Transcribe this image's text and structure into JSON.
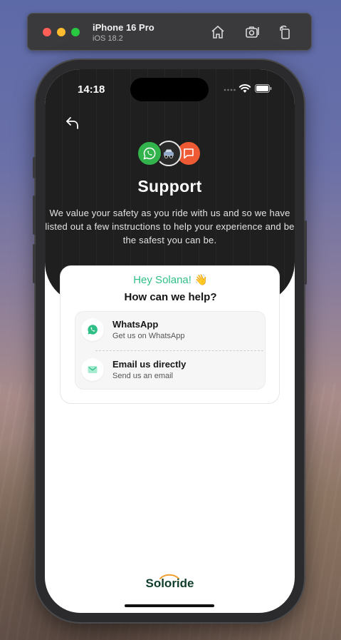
{
  "simulator": {
    "device_name": "iPhone 16 Pro",
    "os_version": "iOS 18.2",
    "icons": [
      "home-icon",
      "screenshot-icon",
      "rotate-icon"
    ]
  },
  "status_bar": {
    "time": "14:18",
    "icons": [
      "cellular-signal-icon",
      "wifi-icon",
      "battery-icon"
    ]
  },
  "header": {
    "back_icon": "back-arrow-icon",
    "cluster_icons": [
      "whatsapp-icon",
      "car-avatar-icon",
      "chat-bubble-icon"
    ],
    "title": "Support",
    "subtitle": "We value your safety as you ride with us and so we have listed out a few instructions to help your experience and be the safest you can be."
  },
  "card": {
    "greeting": "Hey Solana! 👋",
    "question": "How can we help?",
    "options": [
      {
        "icon": "whatsapp-icon",
        "title": "WhatsApp",
        "description": "Get  us on WhatsApp"
      },
      {
        "icon": "email-icon",
        "title": "Email us directly",
        "description": "Send us an email"
      }
    ]
  },
  "footer": {
    "brand": "Soloride"
  },
  "colors": {
    "accent_green": "#2fbf86",
    "header_dark": "#1f1f1f",
    "whatsapp_green": "#32b34b",
    "chat_orange": "#ee5a33",
    "brand_dark_green": "#0f3d2a"
  }
}
